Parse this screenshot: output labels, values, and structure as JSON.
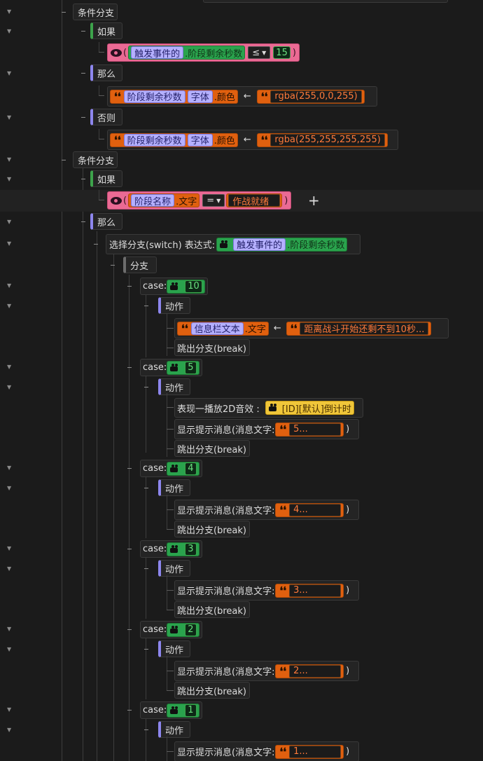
{
  "r0": {
    "label": "条件分支"
  },
  "r1": {
    "label": "如果"
  },
  "r2": {
    "event": "触发事件的",
    "field": ".阶段剩余秒数",
    "op": "≤",
    "num": "15"
  },
  "r3": {
    "label": "那么"
  },
  "r4": {
    "var": "阶段剩余秒数",
    "prop": "字体",
    "field": ".颜色",
    "arrow": "←",
    "value": "rgba(255,0,0,255)"
  },
  "r5": {
    "label": "否则"
  },
  "r6": {
    "var": "阶段剩余秒数",
    "prop": "字体",
    "field": ".颜色",
    "arrow": "←",
    "value": "rgba(255,255,255,255)"
  },
  "r7": {
    "label": "条件分支"
  },
  "r8": {
    "label": "如果"
  },
  "r9": {
    "var": "阶段名称",
    "field": ".文字",
    "op": "=",
    "value": "作战就绪",
    "plus": "+"
  },
  "r10": {
    "label": "那么"
  },
  "r11": {
    "label": "选择分支(switch) 表达式:",
    "event": "触发事件的",
    "field": ".阶段剩余秒数"
  },
  "r12": {
    "label": "分支"
  },
  "case_label": "case:",
  "action_label": "动作",
  "break_label": "跳出分支(break)",
  "msg_label": "显示提示消息(消息文字:",
  "r13": {
    "num": "10"
  },
  "r15": {
    "var": "信息栏文本",
    "field": ".文字",
    "arrow": "←",
    "value": "距离战斗开始还剩不到10秒..."
  },
  "r17": {
    "num": "5"
  },
  "r19": {
    "label": "表现一播放2D音效 :",
    "value": "[ID][默认]倒计时"
  },
  "r20": {
    "value": "5..."
  },
  "r22": {
    "num": "4"
  },
  "r24": {
    "value": "4..."
  },
  "r26": {
    "num": "3"
  },
  "r28": {
    "value": "3..."
  },
  "r30": {
    "num": "2"
  },
  "r32": {
    "value": "2..."
  },
  "r34": {
    "num": "1"
  },
  "r36": {
    "value": "1..."
  },
  "paren_open": "(",
  "paren_close": ")",
  "colors": {
    "green": "#2aa34d",
    "orange": "#e0600f",
    "pink": "#ea6a94",
    "purple": "#b5b0ff",
    "yellow": "#f0c63a",
    "background": "#1b1b1b"
  }
}
